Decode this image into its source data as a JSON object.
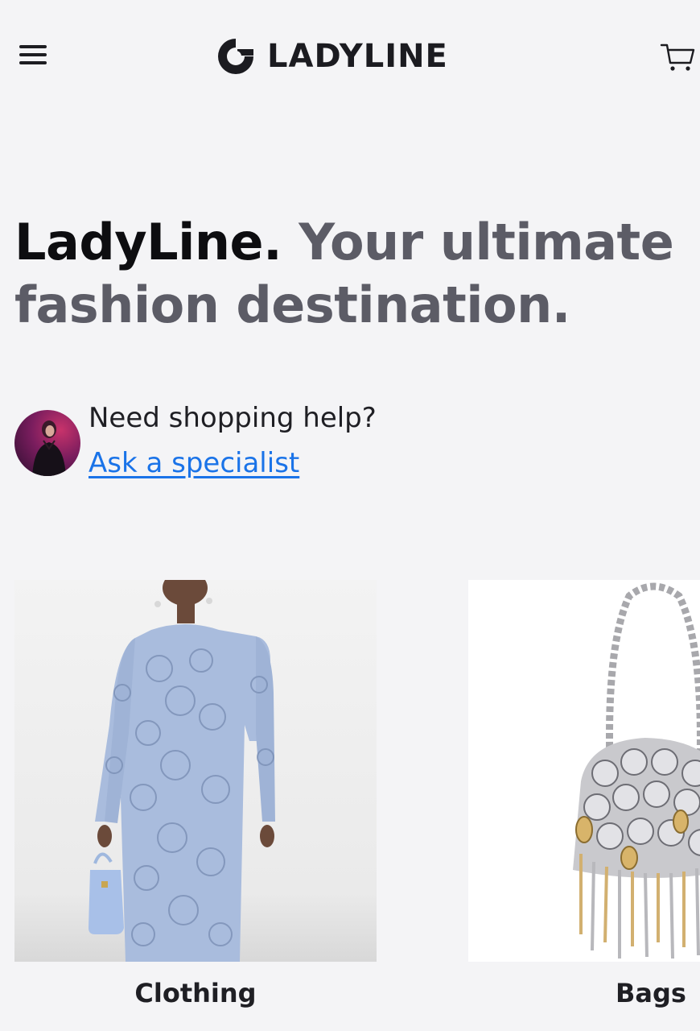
{
  "header": {
    "brand_name": "LADYLINE",
    "menu_icon": "hamburger-menu-icon",
    "logo_icon": "ladyline-logo-icon",
    "cart_icon": "shopping-cart-icon"
  },
  "hero": {
    "brand": "LadyLine.",
    "tagline": "Your ultimate fashion destination."
  },
  "help": {
    "title": "Need shopping help?",
    "link_label": "Ask a specialist",
    "link_color": "#1a73e8"
  },
  "categories": [
    {
      "label": "Clothing"
    },
    {
      "label": "Bags"
    }
  ],
  "colors": {
    "background": "#f4f4f6",
    "heading_primary": "#0d0d10",
    "heading_secondary": "#5c5c66"
  }
}
